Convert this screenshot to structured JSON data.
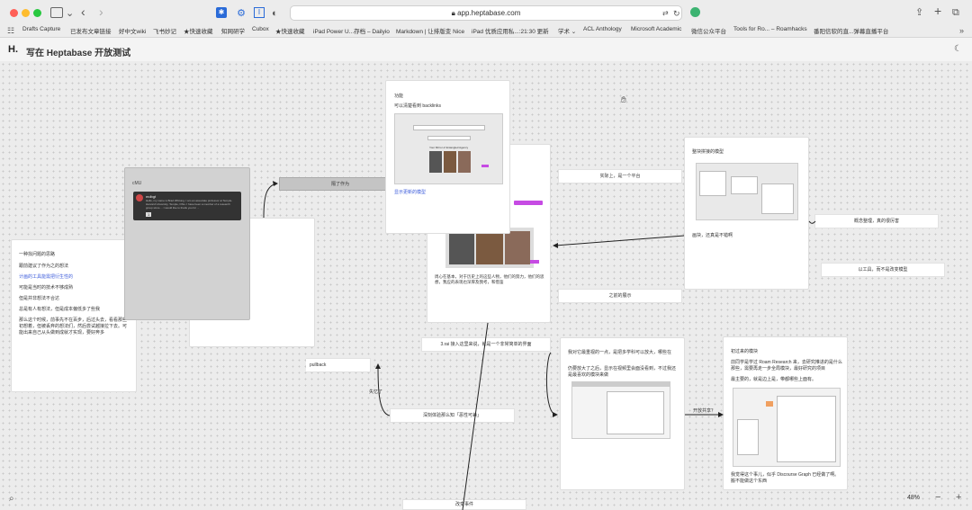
{
  "browser": {
    "url": "app.heptabase.com",
    "bookmarks": [
      "Drafts Capture",
      "已发布文章链接",
      "好中文wiki",
      "飞书妙记",
      "★快速收藏",
      "知网研学",
      "Cubox",
      "★快速收藏",
      "iPad Power U...存档 – Dailyio",
      "Markdown | 让排版变 Nice",
      "iPad 优质应用私...:21:30 更新",
      "学术 ⌄",
      "ACL Anthology",
      "Microsoft Academic",
      "微信公众平台",
      "Tools for Ro... – Roamhacks",
      "番阳信软的直...弹幕直播平台"
    ]
  },
  "app": {
    "logo": "H.",
    "title": "写在 Heptabase 开放测试"
  },
  "cards": {
    "left_text": {
      "lines": [
        "一种找问题的思路",
        "跟前建议了作为之的想法",
        "计画的工具能需把衍生性的",
        "可能是当时的技术不够成熟",
        "但是并非想法不合达",
        "总是有人有想法，但是成本偏低多了些我",
        "那么这个时候，前事先不在百步，后过头去，看看那些初想着，但被丢弃的想法们，然后尝试越接拉下去。可能出来自己从头做到成就才实现，要好奔多"
      ],
      "link_index": 2
    },
    "cmu": {
      "title": "cMU",
      "quote_name": "mdbgt",
      "quote": "Hello, my name is Brad Whitung. I am an associate professor at Temple-Harvard University, Temple, Ohio. I have been a member of a research group since ... I would like to thank you for ...",
      "count": "1"
    },
    "center_top": {
      "title": "功能",
      "subtitle": "可以清楚看到 backlinks",
      "inner_caption": "Your Mirror of Entangled Agency",
      "link": "显示更新的模型"
    },
    "middle": {
      "caption": "周心在基本，对于历史上的这些人物，他们的努力，他们的思想，我应的表现也深厚及我考，和借鉴"
    },
    "right_top": {
      "title": "整块拼接的模型",
      "caption": "画块，还真是不错啊"
    },
    "right_bottom_left": {
      "p1": "我对它最重视的一点，是把多学科可以放大，哪些在",
      "p2": "仍要放大了之后，显示在视频里会面没看到，不过我还是最喜欢的模块来做"
    },
    "right_bottom_right": {
      "title": "初过来的模块",
      "p1": "前同学是学过 Roam Research 来，去研究推进的是什么那些，需要再走一步全局模块，最好研究的项目",
      "p2": "最主要的，就是边上是，带都哪些上面有。",
      "p3": "我觉得这个事儿，似乎 Discourse Graph 已经做了啊。搬不能做这个东西"
    }
  },
  "labels": {
    "hidden_done": "隔了作为",
    "platform": "实际上，是一个平台",
    "concept": "概念整理，真的很厉害",
    "tool": "以工具，而不是改变模型",
    "then_self": "之前的展示",
    "input_stage": "3.rai 接入这里来说，就是一个非常简单的界面",
    "pullback": "pullback",
    "deep_exp": "深刻体验那么知「恶性可兼」",
    "replaced": "失忆了",
    "open_share": "开放共享？",
    "change": "改变事件"
  },
  "footer": {
    "zoom": "48%",
    "zoom_out": "−",
    "zoom_in": "+"
  }
}
